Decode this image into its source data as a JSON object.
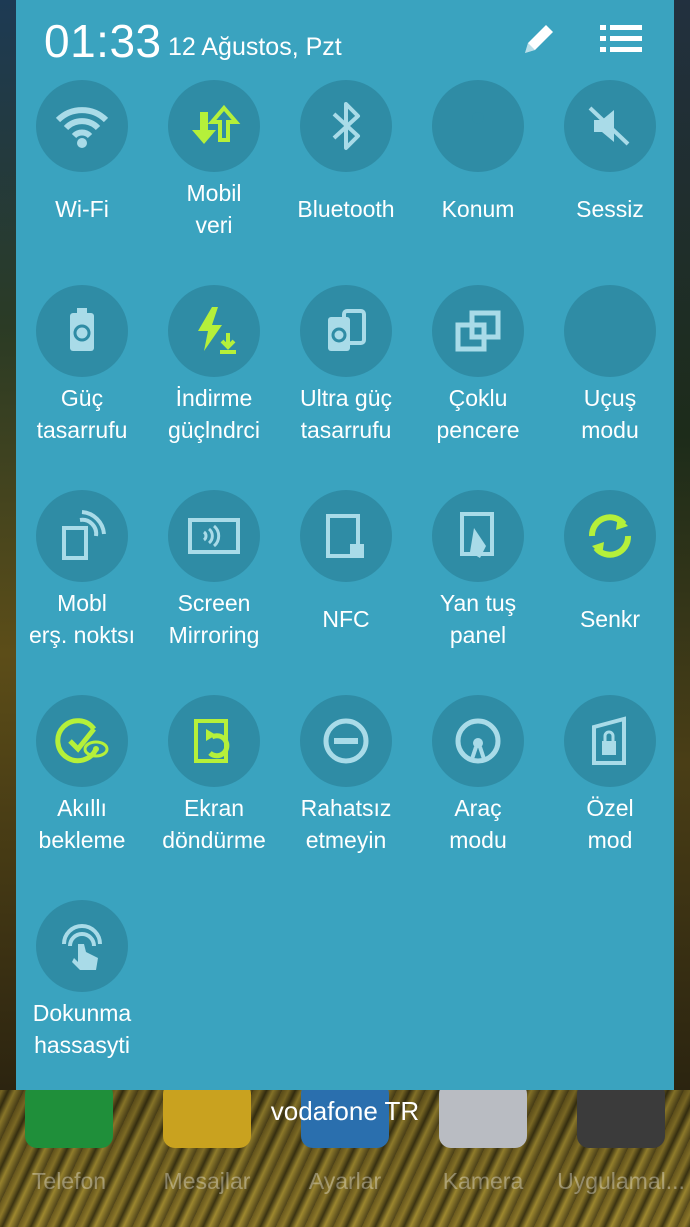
{
  "status": {
    "time": "01:33",
    "date": "12 Ağustos, Pzt"
  },
  "header": {
    "edit_icon": "pencil-icon",
    "list_icon": "list-icon"
  },
  "tiles": [
    {
      "line1": "Wi-Fi",
      "line2": "",
      "icon": "wifi-icon",
      "active": false
    },
    {
      "line1": "Mobil",
      "line2": "veri",
      "icon": "mobile-data-icon",
      "active": true
    },
    {
      "line1": "Bluetooth",
      "line2": "",
      "icon": "bluetooth-icon",
      "active": false
    },
    {
      "line1": "Konum",
      "line2": "",
      "icon": "location-icon",
      "active": false
    },
    {
      "line1": "Sessiz",
      "line2": "",
      "icon": "mute-icon",
      "active": false
    },
    {
      "line1": "Güç",
      "line2": "tasarrufu",
      "icon": "power-saving-icon",
      "active": false
    },
    {
      "line1": "İndirme",
      "line2": "güçlndrci",
      "icon": "download-booster-icon",
      "active": true
    },
    {
      "line1": "Ultra güç",
      "line2": "tasarrufu",
      "icon": "ultra-power-saving-icon",
      "active": false
    },
    {
      "line1": "Çoklu",
      "line2": "pencere",
      "icon": "multi-window-icon",
      "active": false
    },
    {
      "line1": "Uçuş",
      "line2": "modu",
      "icon": "airplane-icon",
      "active": false
    },
    {
      "line1": "Mobl",
      "line2": "erş. noktsı",
      "icon": "hotspot-icon",
      "active": false
    },
    {
      "line1": "Screen",
      "line2": "Mirroring",
      "icon": "screen-mirroring-icon",
      "active": false
    },
    {
      "line1": "NFC",
      "line2": "",
      "icon": "nfc-icon",
      "active": false
    },
    {
      "line1": "Yan tuş",
      "line2": "panel",
      "icon": "side-key-panel-icon",
      "active": false
    },
    {
      "line1": "Senkr",
      "line2": "",
      "icon": "sync-icon",
      "active": true
    },
    {
      "line1": "Akıllı",
      "line2": "bekleme",
      "icon": "smart-stay-icon",
      "active": true
    },
    {
      "line1": "Ekran",
      "line2": "döndürme",
      "icon": "screen-rotation-icon",
      "active": true
    },
    {
      "line1": "Rahatsız",
      "line2": "etmeyin",
      "icon": "do-not-disturb-icon",
      "active": false
    },
    {
      "line1": "Araç",
      "line2": "modu",
      "icon": "car-mode-icon",
      "active": false
    },
    {
      "line1": "Özel",
      "line2": "mod",
      "icon": "private-mode-icon",
      "active": false
    },
    {
      "line1": "Dokunma",
      "line2": "hassasyti",
      "icon": "touch-sensitivity-icon",
      "active": false
    }
  ],
  "carrier": "vodafone TR",
  "dock": [
    {
      "label": "Telefon",
      "icon": "phone-icon",
      "color": "#1f8f3a"
    },
    {
      "label": "Mesajlar",
      "icon": "message-icon",
      "color": "#c9a21f"
    },
    {
      "label": "Ayarlar",
      "icon": "settings-icon",
      "color": "#2a6fae"
    },
    {
      "label": "Kamera",
      "icon": "camera-icon",
      "color": "#b9bcc2"
    },
    {
      "label": "Uygulamal...",
      "icon": "apps-icon",
      "color": "#3b3b3b"
    }
  ],
  "colors": {
    "panel": "#3aa3bf",
    "tile_circle": "#2f8ca5",
    "icon_inactive": "#a9dbe8",
    "icon_active": "#b5f03a"
  }
}
